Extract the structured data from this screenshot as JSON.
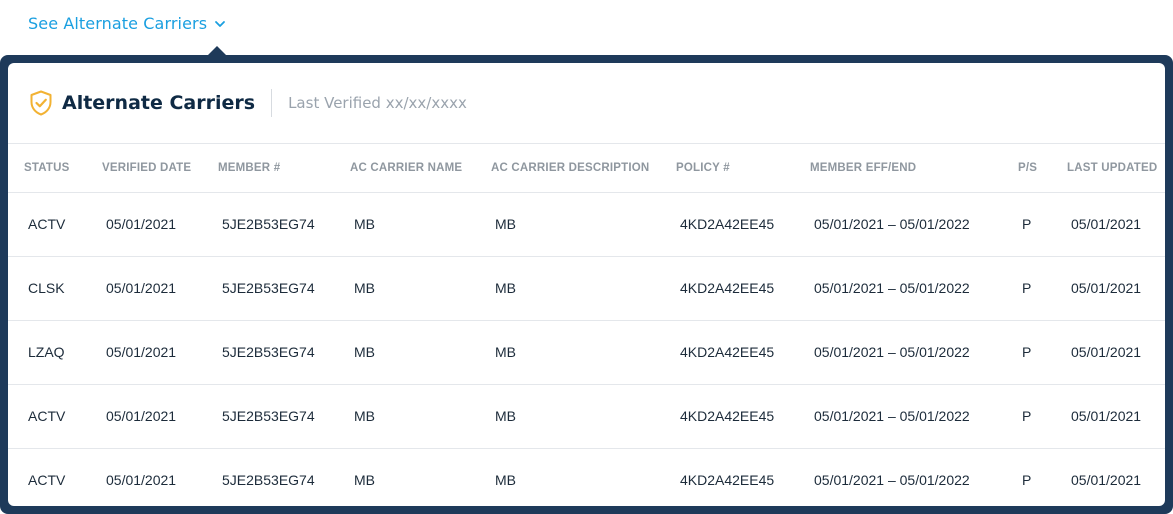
{
  "toggle": {
    "label": "See Alternate Carriers"
  },
  "card": {
    "title": "Alternate Carriers",
    "verified": "Last Verified xx/xx/xxxx"
  },
  "colors": {
    "accent": "#1a9fe0",
    "panel": "#1e3a5a",
    "shield": "#f2b233",
    "title": "#0f2a44"
  },
  "table": {
    "headers": [
      "STATUS",
      "VERIFIED DATE",
      "MEMBER #",
      "AC CARRIER NAME",
      "AC CARRIER DESCRIPTION",
      "POLICY #",
      "MEMBER EFF/END",
      "P/S",
      "LAST UPDATED"
    ],
    "rows": [
      [
        "ACTV",
        "05/01/2021",
        "5JE2B53EG74",
        "MB",
        "MB",
        "4KD2A42EE45",
        "05/01/2021 – 05/01/2022",
        "P",
        "05/01/2021"
      ],
      [
        "CLSK",
        "05/01/2021",
        "5JE2B53EG74",
        "MB",
        "MB",
        "4KD2A42EE45",
        "05/01/2021 – 05/01/2022",
        "P",
        "05/01/2021"
      ],
      [
        "LZAQ",
        "05/01/2021",
        "5JE2B53EG74",
        "MB",
        "MB",
        "4KD2A42EE45",
        "05/01/2021 – 05/01/2022",
        "P",
        "05/01/2021"
      ],
      [
        "ACTV",
        "05/01/2021",
        "5JE2B53EG74",
        "MB",
        "MB",
        "4KD2A42EE45",
        "05/01/2021 – 05/01/2022",
        "P",
        "05/01/2021"
      ],
      [
        "ACTV",
        "05/01/2021",
        "5JE2B53EG74",
        "MB",
        "MB",
        "4KD2A42EE45",
        "05/01/2021 – 05/01/2022",
        "P",
        "05/01/2021"
      ]
    ]
  }
}
